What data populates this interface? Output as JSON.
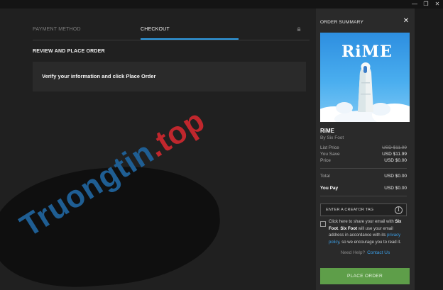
{
  "window": {
    "minimize_glyph": "—",
    "restore_glyph": "❐",
    "close_glyph": "✕"
  },
  "tabs": [
    {
      "label": "PAYMENT METHOD",
      "active": false
    },
    {
      "label": "CHECKOUT",
      "active": true
    }
  ],
  "main": {
    "section_title": "REVIEW AND PLACE ORDER",
    "verify_text": "Verify your information and click Place Order"
  },
  "watermark": {
    "name": "Truongtin",
    "tld": ".top"
  },
  "summary": {
    "title": "ORDER SUMMARY",
    "close_glyph": "✕",
    "art_title": "RiME",
    "game_title": "RiME",
    "by": "By Six Foot",
    "rows": [
      {
        "label": "List Price",
        "value": "USD $11.99"
      },
      {
        "label": "You Save",
        "value": "USD $11.99"
      },
      {
        "label": "Price",
        "value": "USD $0.00"
      }
    ],
    "total": {
      "label": "Total",
      "value": "USD $0.00"
    },
    "you_pay": {
      "label": "You Pay",
      "value": "USD $0.00"
    },
    "creator_tag": "ENTER A CREATOR TAG",
    "info_glyph": "i",
    "share": {
      "pre": "Click here to share your email with ",
      "seller1": "Six Foot",
      "mid1": ". ",
      "seller2": "Six Foot",
      "mid2": " will use your email address in accordance with its ",
      "link": "privacy policy",
      "post": ", so we encourage you to read it."
    },
    "help": "Need Help?",
    "contact": "Contact Us",
    "place_order": "PLACE ORDER"
  },
  "colors": {
    "accent_blue": "#2f9ce4",
    "button_green": "#5e9e49",
    "panel": "#2a2a2a"
  }
}
